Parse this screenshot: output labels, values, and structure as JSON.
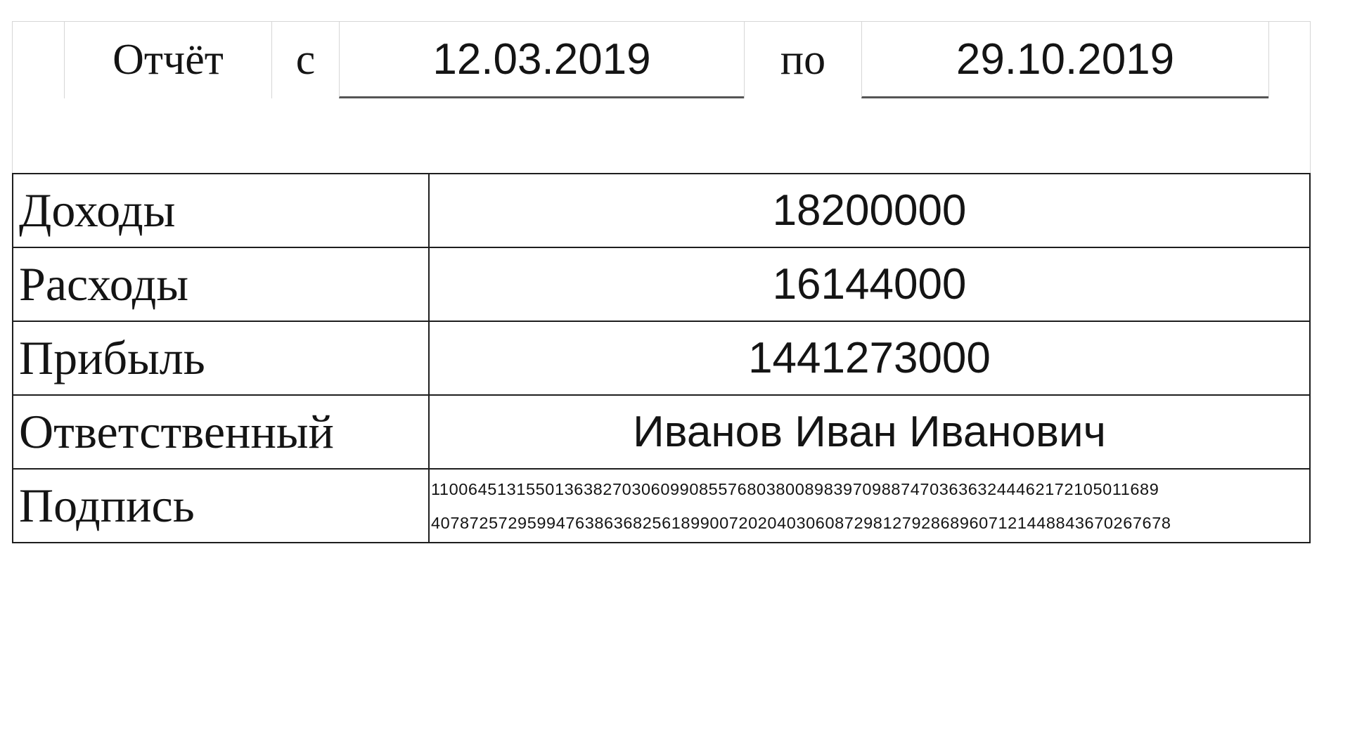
{
  "header": {
    "title": "Отчёт",
    "from_label": "с",
    "date_from": "12.03.2019",
    "to_label": "по",
    "date_to": "29.10.2019"
  },
  "rows": [
    {
      "label": "Доходы",
      "value": "18200000"
    },
    {
      "label": "Расходы",
      "value": "16144000"
    },
    {
      "label": "Прибыль",
      "value": "1441273000"
    },
    {
      "label": "Ответственный",
      "value": "Иванов Иван Иванович"
    }
  ],
  "signature": {
    "label": "Подпись",
    "line1": "1100645131550136382703060990855768038008983970988747036363244462172105011689",
    "line2": "40787257295994763863682561899007202040306087298127928689607121448843670267678"
  }
}
